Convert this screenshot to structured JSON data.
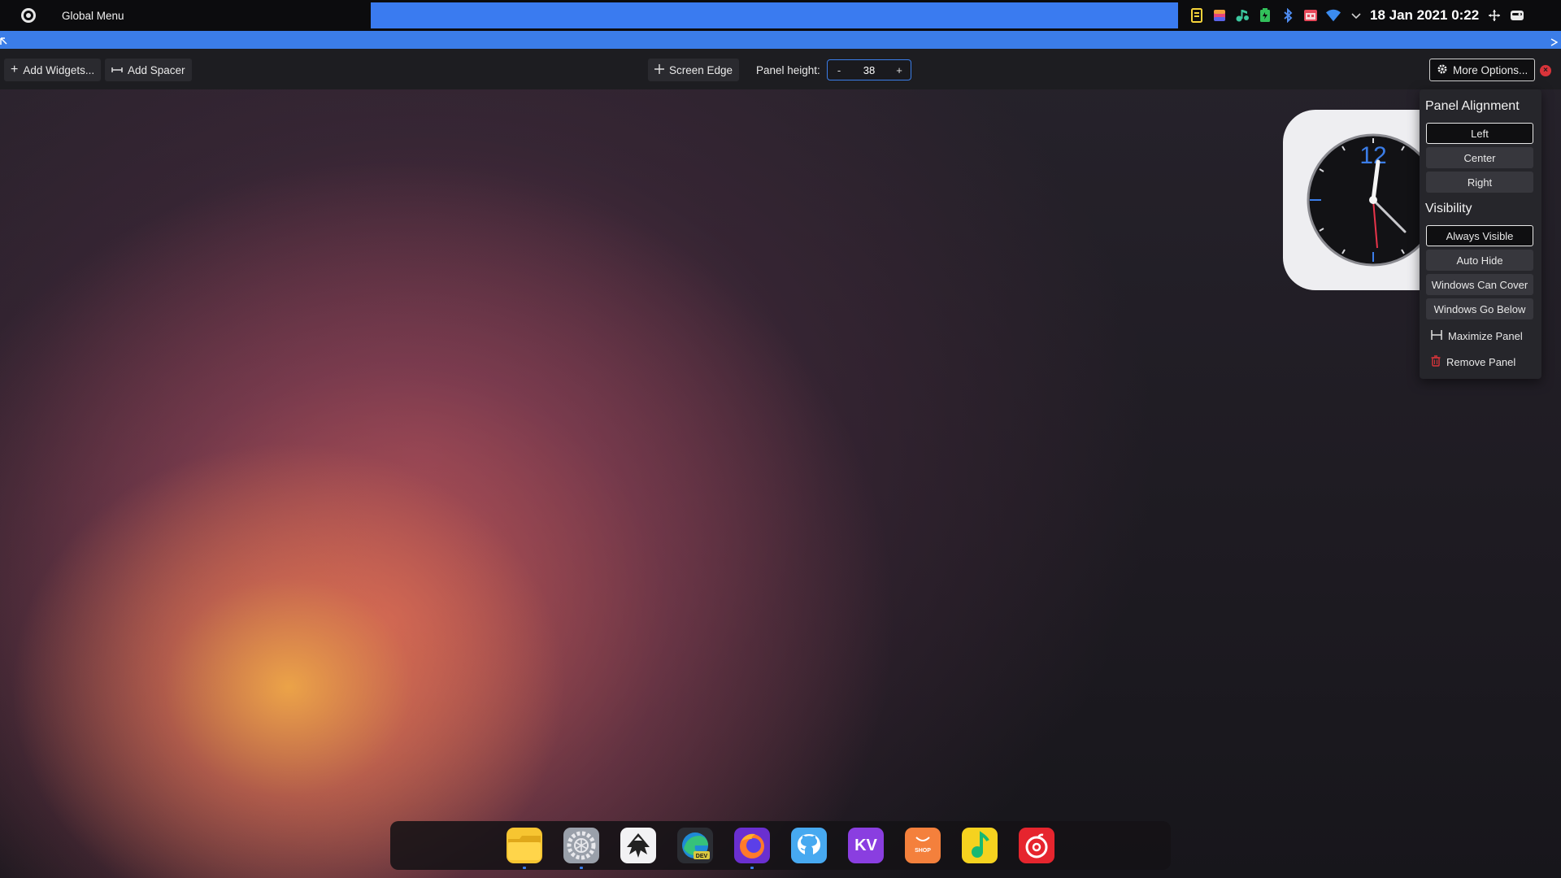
{
  "top_panel": {
    "global_menu_label": "Global Menu",
    "datetime": "18 Jan 2021 0:22",
    "tray_icons": [
      "notes-icon",
      "colorful-app-icon",
      "audio-icon",
      "battery-icon",
      "bluetooth-icon",
      "calendar-icon",
      "wifi-icon",
      "expand-tray-icon"
    ]
  },
  "toolbar": {
    "add_widgets": "Add Widgets...",
    "add_spacer": "Add Spacer",
    "screen_edge": "Screen Edge",
    "panel_height_label": "Panel height:",
    "panel_height_minus": "-",
    "panel_height_value": "38",
    "panel_height_plus": "+",
    "more_options": "More Options..."
  },
  "menu": {
    "alignment_heading": "Panel Alignment",
    "alignment_options": [
      "Left",
      "Center",
      "Right"
    ],
    "alignment_selected": "Left",
    "visibility_heading": "Visibility",
    "visibility_options": [
      "Always Visible",
      "Auto Hide",
      "Windows Can Cover",
      "Windows Go Below"
    ],
    "visibility_selected": "Always Visible",
    "maximize_panel": "Maximize Panel",
    "remove_panel": "Remove Panel"
  },
  "clock_widget": {
    "numeral": "12"
  },
  "dock": {
    "kv_label": "KV",
    "shop_label": "SHOP",
    "dev_badge": "DEV"
  },
  "colors": {
    "accent": "#3b7de8",
    "danger": "#d9343a"
  }
}
